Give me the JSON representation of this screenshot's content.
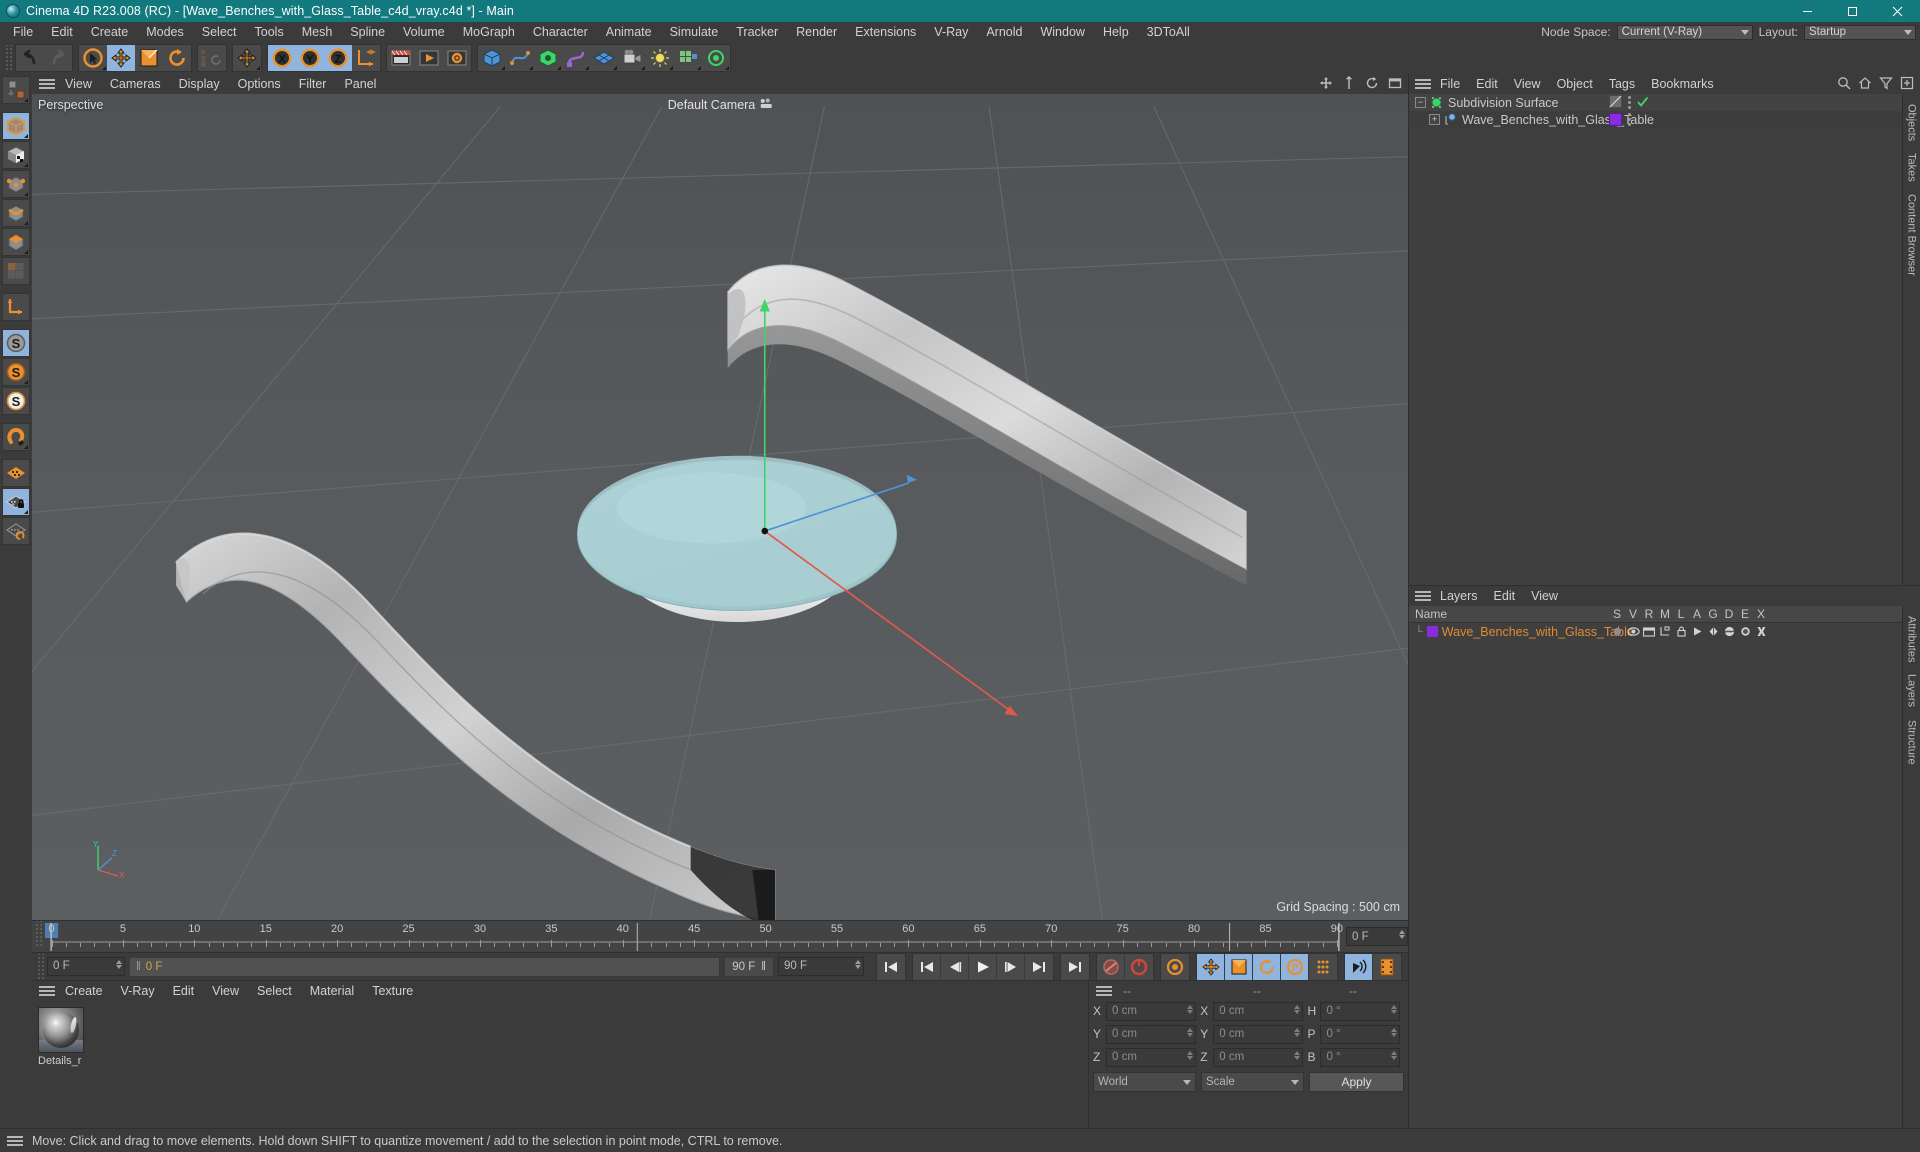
{
  "window": {
    "title": "Cinema 4D R23.008 (RC) - [Wave_Benches_with_Glass_Table_c4d_vray.c4d *] - Main",
    "minimize": "minimize-icon",
    "maximize": "maximize-icon",
    "close": "close-icon"
  },
  "menubar": {
    "items": [
      {
        "label": "File"
      },
      {
        "label": "Edit"
      },
      {
        "label": "Create"
      },
      {
        "label": "Modes"
      },
      {
        "label": "Select"
      },
      {
        "label": "Tools"
      },
      {
        "label": "Mesh"
      },
      {
        "label": "Spline"
      },
      {
        "label": "Volume"
      },
      {
        "label": "MoGraph"
      },
      {
        "label": "Character"
      },
      {
        "label": "Animate"
      },
      {
        "label": "Simulate"
      },
      {
        "label": "Tracker"
      },
      {
        "label": "Render"
      },
      {
        "label": "Extensions"
      },
      {
        "label": "V-Ray"
      },
      {
        "label": "Arnold"
      },
      {
        "label": "Window"
      },
      {
        "label": "Help"
      },
      {
        "label": "3DToAll"
      }
    ],
    "node_space_label": "Node Space:",
    "node_space_value": "Current (V-Ray)",
    "layout_label": "Layout:",
    "layout_value": "Startup"
  },
  "toolbar": {
    "groups": [
      {
        "name": "history",
        "buttons": [
          {
            "name": "undo-button",
            "icon": "undo-icon",
            "active": false
          },
          {
            "name": "redo-button",
            "icon": "redo-icon",
            "active": false
          }
        ]
      },
      {
        "name": "transform",
        "buttons": [
          {
            "name": "select-tool-button",
            "icon": "live-selection-icon",
            "active": false
          },
          {
            "name": "move-tool-button",
            "icon": "move-icon",
            "active": true
          },
          {
            "name": "scale-tool-button",
            "icon": "scale-icon",
            "active": false
          },
          {
            "name": "rotate-tool-button",
            "icon": "rotate-icon",
            "active": false
          }
        ]
      },
      {
        "name": "psr",
        "buttons": [
          {
            "name": "psr-button",
            "icon": "psr-icon",
            "active": false
          }
        ]
      },
      {
        "name": "worldobject",
        "buttons": [
          {
            "name": "world-object-axis-button",
            "icon": "move-icon",
            "active": false
          }
        ]
      },
      {
        "name": "axes",
        "buttons": [
          {
            "name": "x-axis-button",
            "icon": "x-axis-icon",
            "active": true
          },
          {
            "name": "y-axis-button",
            "icon": "y-axis-icon",
            "active": true
          },
          {
            "name": "z-axis-button",
            "icon": "z-axis-icon",
            "active": true
          },
          {
            "name": "object-world-coord-button",
            "icon": "coordinate-system-icon",
            "active": false
          }
        ]
      },
      {
        "name": "render",
        "buttons": [
          {
            "name": "render-view-button",
            "icon": "render-view-icon",
            "active": false
          },
          {
            "name": "render-to-picture-viewer-button",
            "icon": "render-picture-viewer-icon",
            "active": false
          },
          {
            "name": "render-settings-button",
            "icon": "render-settings-icon",
            "active": false
          }
        ]
      },
      {
        "name": "primitives",
        "buttons": [
          {
            "name": "add-cube-button",
            "icon": "cube-icon",
            "active": false
          },
          {
            "name": "add-spline-button",
            "icon": "spline-pen-icon",
            "active": false
          },
          {
            "name": "add-generator-button",
            "icon": "subdivision-surface-icon",
            "active": false
          },
          {
            "name": "add-deformer-button",
            "icon": "bend-deformer-icon",
            "active": false
          },
          {
            "name": "add-environment-button",
            "icon": "floor-environment-icon",
            "active": false
          },
          {
            "name": "add-camera-button",
            "icon": "camera-icon",
            "active": false
          },
          {
            "name": "add-light-button",
            "icon": "light-icon",
            "active": false
          },
          {
            "name": "mograph-button",
            "icon": "mograph-icon",
            "active": false
          },
          {
            "name": "field-button",
            "icon": "field-icon",
            "active": false
          }
        ]
      }
    ]
  },
  "left_tools": [
    {
      "name": "make-editable-button",
      "icon": "make-editable-icon",
      "active": false,
      "gap_after": true
    },
    {
      "name": "model-mode-button",
      "icon": "model-mode-icon",
      "active": true
    },
    {
      "name": "texture-mode-button",
      "icon": "texture-mode-icon",
      "active": false
    },
    {
      "name": "points-mode-button",
      "icon": "points-mode-icon",
      "active": false
    },
    {
      "name": "edges-mode-button",
      "icon": "edges-mode-icon",
      "active": false
    },
    {
      "name": "polygons-mode-button",
      "icon": "polygons-mode-icon",
      "active": false
    },
    {
      "name": "uv-polygons-mode-button",
      "icon": "uv-polygons-icon",
      "active": false,
      "gap_after": true
    },
    {
      "name": "axis-modify-button",
      "icon": "axis-modify-icon",
      "active": false,
      "gap_after": true
    },
    {
      "name": "enable-snapping-button",
      "icon": "snap-grey-icon",
      "active": true
    },
    {
      "name": "snap-settings-button",
      "icon": "snap-orange-icon",
      "active": false
    },
    {
      "name": "quantize-button",
      "icon": "snap-white-icon",
      "active": false,
      "gap_after": true
    },
    {
      "name": "magnet-button",
      "icon": "magnet-icon",
      "active": false,
      "gap_after": true
    },
    {
      "name": "workplane-button",
      "icon": "workplane-icon",
      "active": false
    },
    {
      "name": "lock-workplane-button",
      "icon": "workplane-lock-icon",
      "active": true
    },
    {
      "name": "planar-workplane-button",
      "icon": "workplane-rotate-icon",
      "active": false
    }
  ],
  "viewport": {
    "menu": [
      {
        "label": "View"
      },
      {
        "label": "Cameras"
      },
      {
        "label": "Display"
      },
      {
        "label": "Options"
      },
      {
        "label": "Filter"
      },
      {
        "label": "Panel"
      }
    ],
    "label": "Perspective",
    "camera": "Default Camera",
    "grid_spacing": "Grid Spacing : 500 cm",
    "axis_x": "X",
    "axis_y": "Y",
    "axis_z": "Z",
    "icons": [
      "move-viewport-icon",
      "pan-viewport-icon",
      "rotate-viewport-icon",
      "maximize-viewport-icon"
    ]
  },
  "timeline": {
    "ticks": [
      "0",
      "5",
      "10",
      "15",
      "20",
      "25",
      "30",
      "35",
      "40",
      "45",
      "50",
      "55",
      "60",
      "65",
      "70",
      "75",
      "80",
      "85",
      "90"
    ],
    "start": 0,
    "end": 90,
    "current_frame_field": "0 F",
    "end_field": "0 F"
  },
  "playbar": {
    "current_frame": "0 F",
    "preview_range_start": "0 F",
    "preview_range_end": "90 F",
    "max_frame": "90 F",
    "buttons": [
      {
        "name": "go-to-start-button",
        "icon": "skip-start-icon"
      },
      {
        "name": "go-to-previous-key-button",
        "icon": "prev-key-icon"
      },
      {
        "name": "step-back-button",
        "icon": "step-back-icon"
      },
      {
        "name": "play-button",
        "icon": "play-icon"
      },
      {
        "name": "step-forward-button",
        "icon": "step-forward-icon"
      },
      {
        "name": "go-to-next-key-button",
        "icon": "next-key-icon"
      },
      {
        "name": "go-to-end-button",
        "icon": "skip-end-icon"
      },
      {
        "name": "record-active-objects-button",
        "icon": "record-key-icon"
      },
      {
        "name": "autokeying-button",
        "icon": "autokey-icon"
      },
      {
        "name": "keyframe-selection-button",
        "icon": "key-selection-icon"
      },
      {
        "name": "position-key-button",
        "icon": "position-key-icon"
      },
      {
        "name": "scale-key-button",
        "icon": "scale-key-icon"
      },
      {
        "name": "rotation-key-button",
        "icon": "rotation-key-icon"
      },
      {
        "name": "param-key-button",
        "icon": "param-key-icon"
      },
      {
        "name": "point-level-anim-button",
        "icon": "pla-icon"
      },
      {
        "name": "sound-button",
        "icon": "sound-icon"
      },
      {
        "name": "timeline-filmstrip-button",
        "icon": "filmstrip-icon"
      }
    ]
  },
  "material_manager": {
    "menu": [
      {
        "label": "Create"
      },
      {
        "label": "V-Ray"
      },
      {
        "label": "Edit"
      },
      {
        "label": "View"
      },
      {
        "label": "Select"
      },
      {
        "label": "Material"
      },
      {
        "label": "Texture"
      }
    ],
    "materials": [
      {
        "name": "Details_r",
        "thumb": "sphere-preview"
      }
    ]
  },
  "coordinates": {
    "header": [
      "--",
      "--",
      "--"
    ],
    "rows": [
      {
        "label1": "X",
        "value1": "0 cm",
        "label2": "X",
        "value2": "0 cm",
        "label3": "H",
        "value3": "0 °"
      },
      {
        "label1": "Y",
        "value1": "0 cm",
        "label2": "Y",
        "value2": "0 cm",
        "label3": "P",
        "value3": "0 °"
      },
      {
        "label1": "Z",
        "value1": "0 cm",
        "label2": "Z",
        "value2": "0 cm",
        "label3": "B",
        "value3": "0 °"
      }
    ],
    "space_select": "World",
    "mode_select": "Scale",
    "apply_button": "Apply"
  },
  "object_manager": {
    "menu": [
      {
        "label": "File"
      },
      {
        "label": "Edit"
      },
      {
        "label": "View"
      },
      {
        "label": "Object"
      },
      {
        "label": "Tags"
      },
      {
        "label": "Bookmarks"
      }
    ],
    "icons": [
      "search-icon",
      "home-icon",
      "filter-icon",
      "add-layer-icon"
    ],
    "rows": [
      {
        "name": "Subdivision Surface",
        "depth": 0,
        "icon": "subdivision-surface-icon",
        "color": "#3fd46a",
        "tag": "phong-tag",
        "checked": true
      },
      {
        "name": "Wave_Benches_with_Glass_Table",
        "depth": 1,
        "icon": "polygon-object-icon",
        "color": "#7fb6e8",
        "tag": "layer-tag",
        "tag_color": "#8a2be2"
      }
    ]
  },
  "layer_manager": {
    "menu": [
      {
        "label": "Layers"
      },
      {
        "label": "Edit"
      },
      {
        "label": "View"
      }
    ],
    "columns": [
      "Name",
      "S",
      "V",
      "R",
      "M",
      "L",
      "A",
      "G",
      "D",
      "E",
      "X"
    ],
    "rows": [
      {
        "name": "Wave_Benches_with_Glass_Table",
        "color": "#8a2be2",
        "icons": [
          "solo-icon",
          "visible-icon",
          "render-icon",
          "manager-icon",
          "lock-icon",
          "animation-icon",
          "generator-icon",
          "deformer-icon",
          "expression-icon",
          "xpresso-icon"
        ]
      }
    ]
  },
  "right_tabs": [
    "Objects",
    "Takes",
    "Content Browser"
  ],
  "right_tabs_lower": [
    "Attributes",
    "Layers",
    "Structure"
  ],
  "statusbar": {
    "message": "Move: Click and drag to move elements. Hold down SHIFT to quantize movement / add to the selection in point mode, CTRL to remove."
  },
  "colors": {
    "title_bar": "#127a7e",
    "panel": "#3b3b3b",
    "viewport_bg": "#555759",
    "accent_orange": "#e08a33",
    "active_blue": "#8fb4de",
    "layer_purple": "#8a2be2",
    "glass_table": "#a8cdd1"
  }
}
